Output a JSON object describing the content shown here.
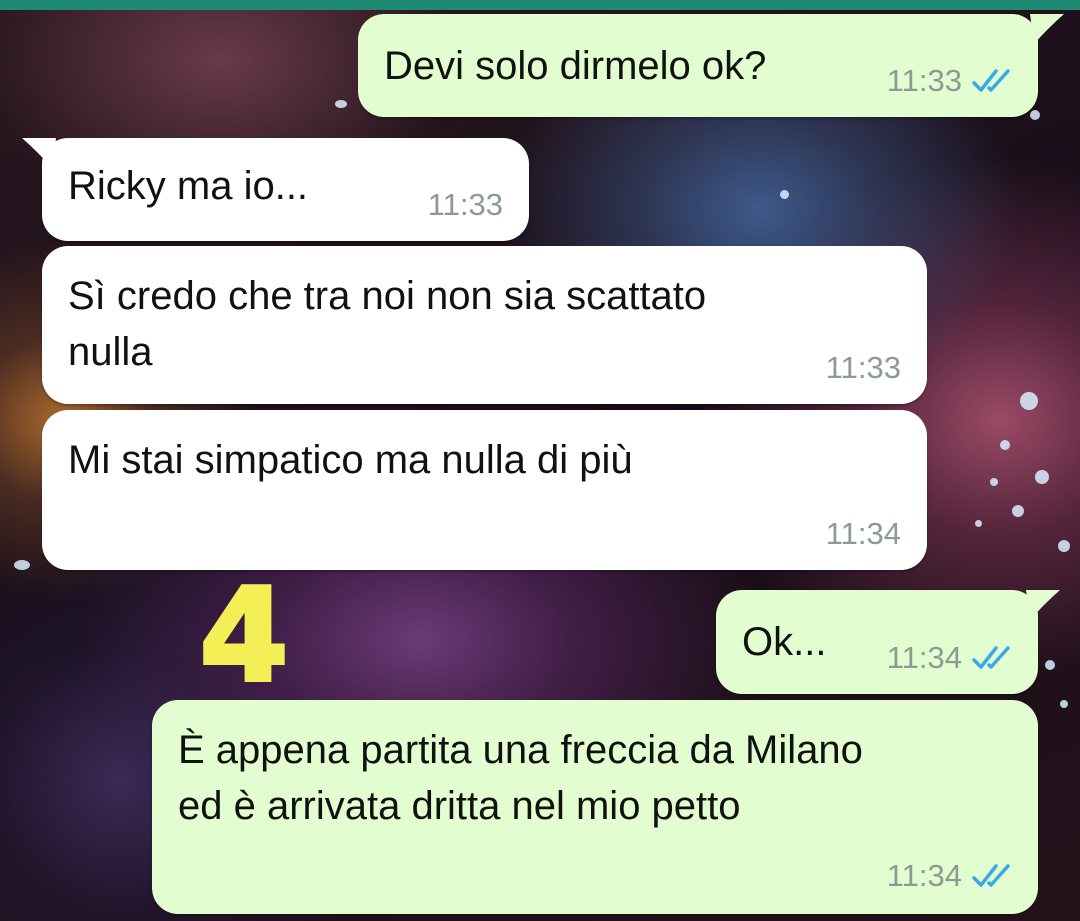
{
  "theme": {
    "incoming_bubble": "#ffffff",
    "outgoing_bubble": "#e2fdcf",
    "read_ticks": "#3aa9e8",
    "annotation": "#f3ef55",
    "header_accent": "#1f8a73"
  },
  "annotation": {
    "text": "4",
    "icon": "handwritten-number"
  },
  "messages": [
    {
      "direction": "outgoing",
      "text": "Devi solo dirmelo ok?",
      "time": "11:33",
      "status": "read"
    },
    {
      "direction": "incoming",
      "text": "Ricky ma io...",
      "time": "11:33"
    },
    {
      "direction": "incoming",
      "lines": [
        "Sì credo che tra noi non sia scattato",
        "nulla"
      ],
      "time": "11:33"
    },
    {
      "direction": "incoming",
      "text": "Mi stai simpatico ma nulla di più",
      "time": "11:34"
    },
    {
      "direction": "outgoing",
      "text": "Ok...",
      "time": "11:34",
      "status": "read"
    },
    {
      "direction": "outgoing",
      "lines": [
        "È appena partita una freccia da Milano",
        "ed è arrivata dritta nel mio petto"
      ],
      "time": "11:34",
      "status": "read"
    }
  ]
}
